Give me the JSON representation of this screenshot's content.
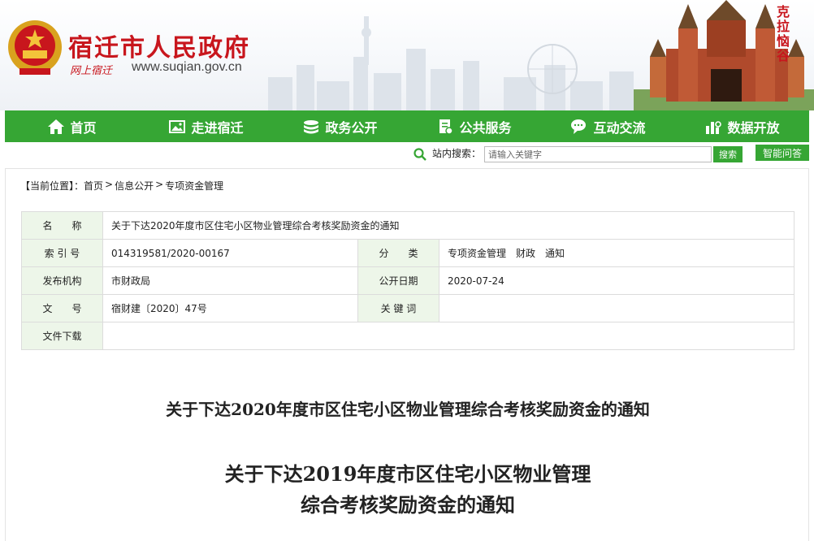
{
  "header": {
    "site_title": "宿迁市人民政府",
    "slogan": "网上宿迁",
    "url": "www.suqian.gov.cn",
    "calligraphy": "克拉恼谷"
  },
  "nav": [
    {
      "label": "首页",
      "icon": "home-icon"
    },
    {
      "label": "走进宿迁",
      "icon": "image-icon"
    },
    {
      "label": "政务公开",
      "icon": "stack-icon"
    },
    {
      "label": "公共服务",
      "icon": "document-icon"
    },
    {
      "label": "互动交流",
      "icon": "chat-icon"
    },
    {
      "label": "数据开放",
      "icon": "chart-icon"
    }
  ],
  "search": {
    "label": "站内搜索：",
    "placeholder": "请输入关键字",
    "button": "搜索",
    "qa_button": "智能问答"
  },
  "breadcrumb": {
    "prefix": "【当前位置】：",
    "items": [
      "首页",
      "信息公开",
      "专项资金管理"
    ],
    "sep": ">"
  },
  "info": {
    "name_label": "名　　称",
    "name_value": "关于下达2020年度市区住宅小区物业管理综合考核奖励资金的通知",
    "index_label": "索 引 号",
    "index_value": "014319581/2020-00167",
    "category_label": "分　　类",
    "category_value": "专项资金管理　财政　通知",
    "org_label": "发布机构",
    "org_value": "市财政局",
    "date_label": "公开日期",
    "date_value": "2020-07-24",
    "docno_label": "文　　号",
    "docno_value": "宿财建〔2020〕47号",
    "keyword_label": "关 键 词",
    "keyword_value": "",
    "download_label": "文件下载",
    "download_value": ""
  },
  "article": {
    "title": "关于下达2020年度市区住宅小区物业管理综合考核奖励资金的通知",
    "doc_title_line1": "关于下达2019年度市区住宅小区物业管理",
    "doc_title_line2": "综合考核奖励资金的通知"
  },
  "colors": {
    "brand_green": "#36a634",
    "brand_red": "#c8161d",
    "label_bg": "#edf6e9"
  }
}
